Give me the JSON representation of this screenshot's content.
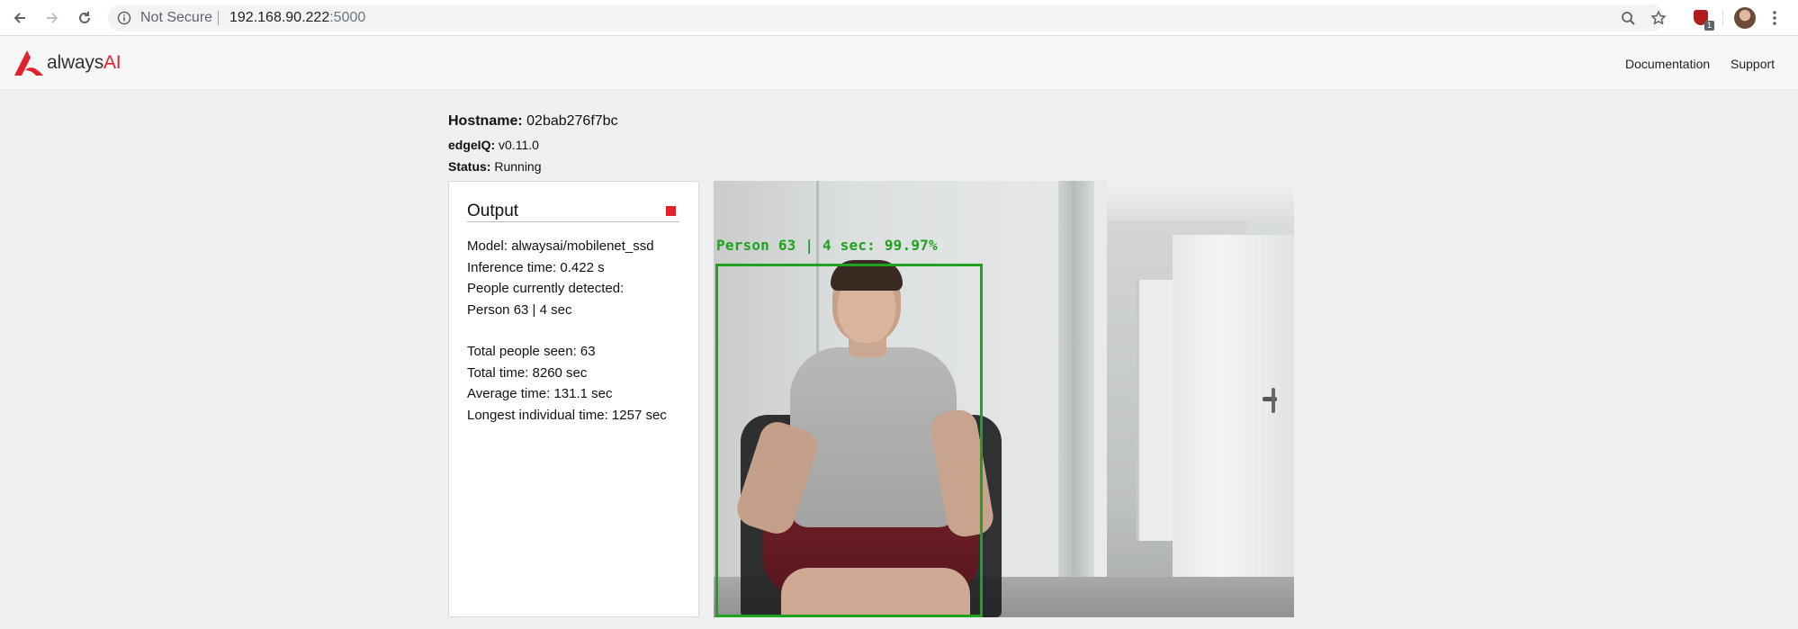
{
  "browser": {
    "security_label": "Not Secure",
    "url_host": "192.168.90.222",
    "url_port": ":5000",
    "extension_badge_count": "1"
  },
  "header": {
    "logo_text_prefix": "always",
    "logo_text_suffix": "AI",
    "brand_color": "#e2222b",
    "nav": [
      "Documentation",
      "Support"
    ]
  },
  "status": {
    "hostname_label": "Hostname:",
    "hostname_value": "02bab276f7bc",
    "edgeiq_label": "edgeIQ:",
    "edgeiq_value": "v0.11.0",
    "status_label": "Status:",
    "status_value": "Running"
  },
  "output": {
    "title": "Output",
    "lines_current": [
      "Model: alwaysai/mobilenet_ssd",
      "Inference time: 0.422 s",
      "People currently detected:",
      "Person 63 | 4 sec"
    ],
    "lines_totals": [
      "Total people seen: 63",
      "Total time: 8260 sec",
      "Average time: 131.1 sec",
      "Longest individual time: 1257 sec"
    ]
  },
  "video": {
    "detection_label": "Person 63 | 4 sec: 99.97%",
    "box_color": "#1fa21f"
  }
}
